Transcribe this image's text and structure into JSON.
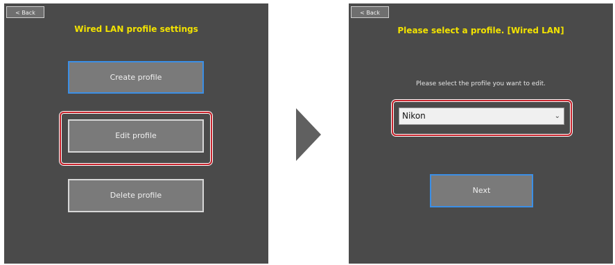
{
  "left": {
    "back_label": "< Back",
    "title": "Wired LAN profile settings",
    "buttons": [
      "Create profile",
      "Edit profile",
      "Delete profile"
    ]
  },
  "right": {
    "back_label": "< Back",
    "title": "Please select a profile. [Wired LAN]",
    "instruction": "Please select the profile you want to edit.",
    "selected_profile": "Nikon",
    "next_label": "Next"
  },
  "icons": {
    "step_arrow": "right-triangle-arrow",
    "dropdown": "chevron-down-icon"
  },
  "colors": {
    "panel_bg": "#4a4a4a",
    "title": "#f2e200",
    "focus_border": "#3b8fe6",
    "highlight": "#c8232c"
  }
}
